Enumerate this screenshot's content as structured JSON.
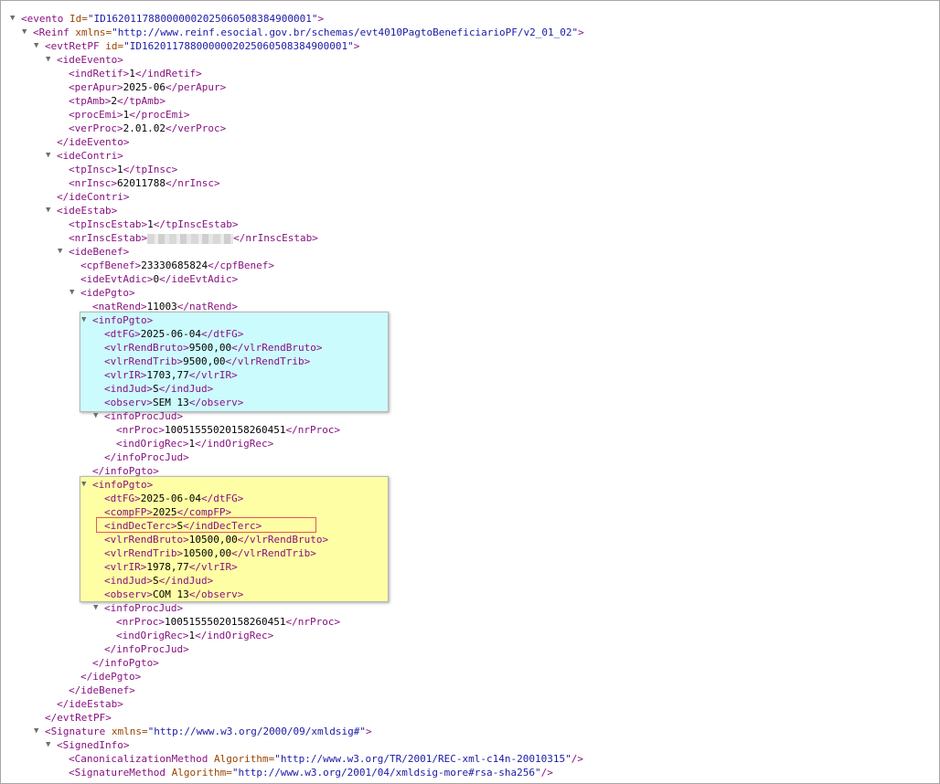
{
  "lines": [
    {
      "d": 0,
      "tog": "open",
      "kind": "open",
      "tag": "evento",
      "attr": "Id",
      "val": "ID1620117880000002025060508384900001"
    },
    {
      "d": 1,
      "tog": "open",
      "kind": "open",
      "tag": "Reinf",
      "attr": "xmlns",
      "val": "http://www.reinf.esocial.gov.br/schemas/evt4010PagtoBeneficiarioPF/v2_01_02"
    },
    {
      "d": 2,
      "tog": "open",
      "kind": "open",
      "tag": "evtRetPF",
      "attr": "id",
      "val": "ID1620117880000002025060508384900001"
    },
    {
      "d": 3,
      "tog": "open",
      "kind": "open",
      "tag": "ideEvento"
    },
    {
      "d": 4,
      "kind": "leaf",
      "tag": "indRetif",
      "text": "1"
    },
    {
      "d": 4,
      "kind": "leaf",
      "tag": "perApur",
      "text": "2025-06"
    },
    {
      "d": 4,
      "kind": "leaf",
      "tag": "tpAmb",
      "text": "2"
    },
    {
      "d": 4,
      "kind": "leaf",
      "tag": "procEmi",
      "text": "1"
    },
    {
      "d": 4,
      "kind": "leaf",
      "tag": "verProc",
      "text": "2.01.02"
    },
    {
      "d": 3,
      "kind": "close",
      "tag": "ideEvento"
    },
    {
      "d": 3,
      "tog": "open",
      "kind": "open",
      "tag": "ideContri"
    },
    {
      "d": 4,
      "kind": "leaf",
      "tag": "tpInsc",
      "text": "1"
    },
    {
      "d": 4,
      "kind": "leaf",
      "tag": "nrInsc",
      "text": "62011788"
    },
    {
      "d": 3,
      "kind": "close",
      "tag": "ideContri"
    },
    {
      "d": 3,
      "tog": "open",
      "kind": "open",
      "tag": "ideEstab"
    },
    {
      "d": 4,
      "kind": "leaf",
      "tag": "tpInscEstab",
      "text": "1"
    },
    {
      "d": 4,
      "kind": "leaf",
      "tag": "nrInscEstab",
      "text": "",
      "redacted": true
    },
    {
      "d": 4,
      "tog": "open",
      "kind": "open",
      "tag": "ideBenef"
    },
    {
      "d": 5,
      "kind": "leaf",
      "tag": "cpfBenef",
      "text": "23330685824"
    },
    {
      "d": 5,
      "kind": "leaf",
      "tag": "ideEvtAdic",
      "text": "0"
    },
    {
      "d": 5,
      "tog": "open",
      "kind": "open",
      "tag": "idePgto"
    },
    {
      "d": 6,
      "kind": "leaf",
      "tag": "natRend",
      "text": "11003"
    },
    {
      "d": 6,
      "tog": "open",
      "kind": "open",
      "tag": "infoPgto"
    },
    {
      "d": 7,
      "kind": "leaf",
      "tag": "dtFG",
      "text": "2025-06-04"
    },
    {
      "d": 7,
      "kind": "leaf",
      "tag": "vlrRendBruto",
      "text": "9500,00"
    },
    {
      "d": 7,
      "kind": "leaf",
      "tag": "vlrRendTrib",
      "text": "9500,00"
    },
    {
      "d": 7,
      "kind": "leaf",
      "tag": "vlrIR",
      "text": "1703,77"
    },
    {
      "d": 7,
      "kind": "leaf",
      "tag": "indJud",
      "text": "S"
    },
    {
      "d": 7,
      "kind": "leaf",
      "tag": "observ",
      "text": "SEM 13"
    },
    {
      "d": 7,
      "tog": "open",
      "kind": "open",
      "tag": "infoProcJud"
    },
    {
      "d": 8,
      "kind": "leaf",
      "tag": "nrProc",
      "text": "10051555020158260451"
    },
    {
      "d": 8,
      "kind": "leaf",
      "tag": "indOrigRec",
      "text": "1"
    },
    {
      "d": 7,
      "kind": "close",
      "tag": "infoProcJud"
    },
    {
      "d": 6,
      "kind": "close",
      "tag": "infoPgto"
    },
    {
      "d": 6,
      "tog": "open",
      "kind": "open",
      "tag": "infoPgto"
    },
    {
      "d": 7,
      "kind": "leaf",
      "tag": "dtFG",
      "text": "2025-06-04"
    },
    {
      "d": 7,
      "kind": "leaf",
      "tag": "compFP",
      "text": "2025"
    },
    {
      "d": 7,
      "kind": "leaf",
      "tag": "indDecTerc",
      "text": "S"
    },
    {
      "d": 7,
      "kind": "leaf",
      "tag": "vlrRendBruto",
      "text": "10500,00"
    },
    {
      "d": 7,
      "kind": "leaf",
      "tag": "vlrRendTrib",
      "text": "10500,00"
    },
    {
      "d": 7,
      "kind": "leaf",
      "tag": "vlrIR",
      "text": "1978,77"
    },
    {
      "d": 7,
      "kind": "leaf",
      "tag": "indJud",
      "text": "S"
    },
    {
      "d": 7,
      "kind": "leaf",
      "tag": "observ",
      "text": "COM 13"
    },
    {
      "d": 7,
      "tog": "open",
      "kind": "open",
      "tag": "infoProcJud"
    },
    {
      "d": 8,
      "kind": "leaf",
      "tag": "nrProc",
      "text": "10051555020158260451"
    },
    {
      "d": 8,
      "kind": "leaf",
      "tag": "indOrigRec",
      "text": "1"
    },
    {
      "d": 7,
      "kind": "close",
      "tag": "infoProcJud"
    },
    {
      "d": 6,
      "kind": "close",
      "tag": "infoPgto"
    },
    {
      "d": 5,
      "kind": "close",
      "tag": "idePgto"
    },
    {
      "d": 4,
      "kind": "close",
      "tag": "ideBenef"
    },
    {
      "d": 3,
      "kind": "close",
      "tag": "ideEstab"
    },
    {
      "d": 2,
      "kind": "close",
      "tag": "evtRetPF"
    },
    {
      "d": 2,
      "tog": "open",
      "kind": "open",
      "tag": "Signature",
      "attr": "xmlns",
      "val": "http://www.w3.org/2000/09/xmldsig#"
    },
    {
      "d": 3,
      "tog": "open",
      "kind": "open",
      "tag": "SignedInfo"
    },
    {
      "d": 4,
      "kind": "selfclose",
      "tag": "CanonicalizationMethod",
      "attr": "Algorithm",
      "val": "http://www.w3.org/TR/2001/REC-xml-c14n-20010315"
    },
    {
      "d": 4,
      "kind": "selfclose",
      "tag": "SignatureMethod",
      "attr": "Algorithm",
      "val": "http://www.w3.org/2001/04/xmldsig-more#rsa-sha256"
    }
  ],
  "colors": {
    "tag": "#881280",
    "attr": "#994500",
    "value": "#1a1aa6",
    "highlight_cyan": "#ccfbfd",
    "highlight_yellow": "#fefea4",
    "annotation_box": "#e05a5a"
  },
  "icons": {
    "expanded": "triangle-down-icon"
  }
}
